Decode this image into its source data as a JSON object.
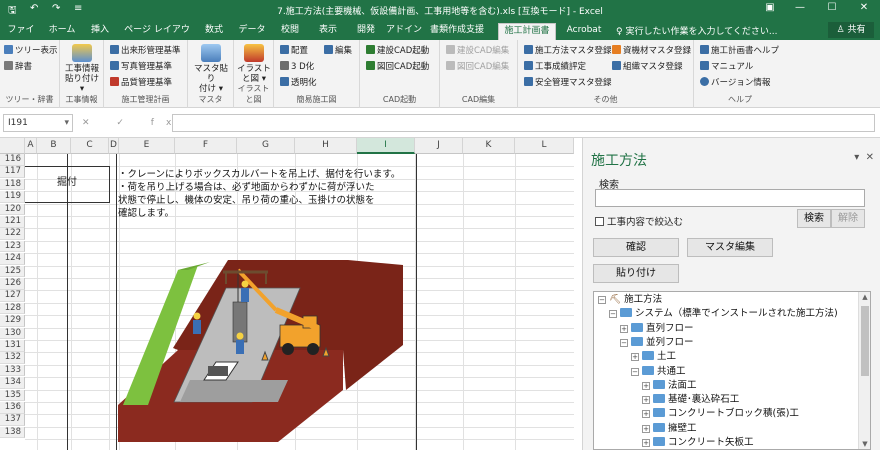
{
  "window": {
    "title": "7.施工方法(主要機械、仮設備計画、工事用地等を含む).xls  [互換モード]  -  Excel",
    "controls": {
      "minimize": "—",
      "maximize": "☐",
      "close": "✕",
      "ribbon_options": "▣"
    }
  },
  "quick_access": {
    "save": "🖫",
    "undo": "↶",
    "redo": "↷",
    "more": "≡"
  },
  "ribbon_tabs": [
    "ファイル",
    "ホーム",
    "挿入",
    "ページ レイアウト",
    "数式",
    "データ",
    "校閲",
    "表示",
    "開発",
    "アドイン",
    "書類作成支援",
    "施工計画書",
    "Acrobat"
  ],
  "active_tab": "施工計画書",
  "tell_me": "♀ 実行したい作業を入力してください...",
  "share": "♙ 共有",
  "ribbon": {
    "group_tree": {
      "label": "ツリー・辞書",
      "tree_view": "ツリー表示",
      "dictionary": "辞書"
    },
    "group_info": {
      "label": "工事情報",
      "paste_line1": "工事情報",
      "paste_line2": "貼り付け ▾"
    },
    "group_mgmt": {
      "label": "施工管理計画",
      "shape": "出来形管理基準",
      "photo": "写真管理基準",
      "quality": "品質管理基準"
    },
    "group_master": {
      "label": "マスタ",
      "line1": "マスタ貼り",
      "line2": "付け ▾"
    },
    "group_illust": {
      "label": "イラストと図",
      "line1": "イラスト",
      "line2": "と図 ▾"
    },
    "group_simple": {
      "label": "簡易施工図",
      "place": "配置",
      "edit": "編集",
      "d3": "3 D化",
      "transparent": "透明化"
    },
    "group_cad": {
      "label": "CAD起動",
      "kensetsu": "建設CAD起動",
      "zumen": "図回CAD起動"
    },
    "group_cadedit": {
      "label": "CAD編集",
      "kensetsu": "建設CAD編集",
      "zumen": "図回CAD編集"
    },
    "group_other": {
      "label": "その他",
      "method_master": "施工方法マスタ登録",
      "eval": "工事成績評定",
      "safety": "安全管理マスタ登録",
      "material": "資機材マスタ登録",
      "org": "組織マスタ登録"
    },
    "group_help": {
      "label": "ヘルプ",
      "help": "施工計画書ヘルプ",
      "manual": "マニュアル",
      "version": "バージョン情報"
    }
  },
  "formula_bar": {
    "name_box": "I191",
    "fx_icons": "✕ ✓ fx",
    "formula": ""
  },
  "sheet": {
    "columns": [
      "A",
      "B",
      "C",
      "D",
      "E",
      "F",
      "G",
      "H",
      "I",
      "J",
      "K",
      "L"
    ],
    "selected_column": "I",
    "rows": [
      "116",
      "117",
      "118",
      "119",
      "120",
      "121",
      "122",
      "123",
      "124",
      "125",
      "126",
      "127",
      "128",
      "129",
      "130",
      "131",
      "132",
      "133",
      "134",
      "135",
      "136",
      "137",
      "138"
    ],
    "cell_C118": "掘付",
    "notes": [
      "・クレーンによりボックスカルバートを吊上げ、据付を行います。",
      "・荷を吊り上げる場合は、必ず地面からわずかに荷が浮いた",
      "状態で停止し、機体の安定、吊り荷の重心、玉掛けの状態を",
      "確認します。"
    ]
  },
  "pane": {
    "title": "施工方法",
    "dropdown": "▾",
    "close": "✕",
    "search_label": "検索",
    "search_value": "",
    "checkbox_label": "工事内容で絞込む",
    "search_button": "検索",
    "clear_button": "解除",
    "confirm_button": "確認",
    "master_edit_button": "マスタ編集",
    "paste_button": "貼り付け",
    "tree": [
      {
        "label": "施工方法",
        "level": 0,
        "toggle": "−",
        "icon": "root"
      },
      {
        "label": "システム（標準でインストールされた施工方法)",
        "level": 1,
        "toggle": "−",
        "icon": "folder"
      },
      {
        "label": "直列フロー",
        "level": 2,
        "toggle": "+",
        "icon": "folder"
      },
      {
        "label": "並列フロー",
        "level": 2,
        "toggle": "−",
        "icon": "folder"
      },
      {
        "label": "土工",
        "level": 3,
        "toggle": "+",
        "icon": "folder"
      },
      {
        "label": "共通工",
        "level": 3,
        "toggle": "−",
        "icon": "folder"
      },
      {
        "label": "法面工",
        "level": 4,
        "toggle": "+",
        "icon": "folder"
      },
      {
        "label": "基礎･裏込砕石工",
        "level": 4,
        "toggle": "+",
        "icon": "folder"
      },
      {
        "label": "コンクリートブロック積(張)工",
        "level": 4,
        "toggle": "+",
        "icon": "folder"
      },
      {
        "label": "擁壁工",
        "level": 4,
        "toggle": "+",
        "icon": "folder"
      },
      {
        "label": "コンクリート矢板工",
        "level": 4,
        "toggle": "+",
        "icon": "folder"
      }
    ]
  },
  "colors": {
    "excel_green": "#217346",
    "ribbon_bg": "#f3f3f3",
    "pane_bg": "#f3f3f3",
    "ground_red": "#8b2a1f",
    "grass": "#7dc13f",
    "crane_orange": "#f2a22c"
  }
}
